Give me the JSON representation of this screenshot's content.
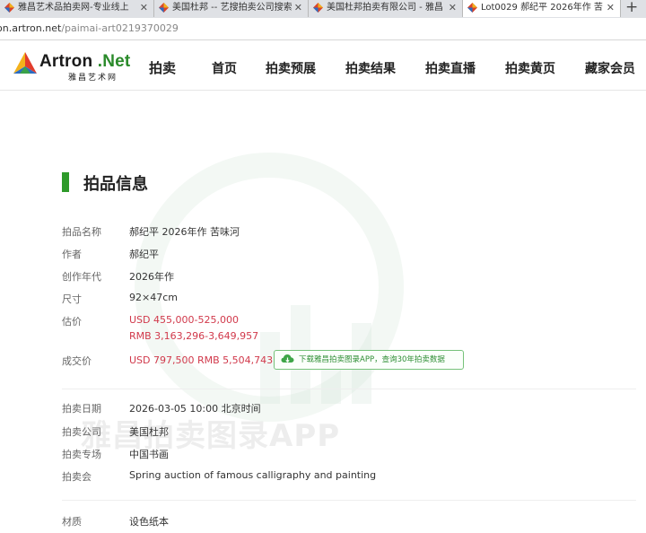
{
  "tabs": [
    {
      "label": "雅昌艺术品拍卖网-专业线上",
      "active": false
    },
    {
      "label": "美国杜邦 -- 艺搜拍卖公司搜索",
      "active": false
    },
    {
      "label": "美国杜邦拍卖有限公司 - 雅昌",
      "active": false
    },
    {
      "label": "Lot0029 郝纪平 2026年作 苦",
      "active": true
    }
  ],
  "new_tab_label": "+",
  "address": {
    "host": "on.artron.net",
    "path": "/paimai-art0219370029"
  },
  "logo": {
    "name": "Artron",
    "dot_net": ".Net",
    "subtitle": "雅昌艺术网"
  },
  "nav": {
    "section": "拍卖",
    "items": [
      "首页",
      "拍卖预展",
      "拍卖结果",
      "拍卖直播",
      "拍卖黄页",
      "藏家会员"
    ]
  },
  "section_title": "拍品信息",
  "details": {
    "name_label": "拍品名称",
    "name_value": "郝纪平 2026年作 苦味河",
    "author_label": "作者",
    "author_value": "郝纪平",
    "year_label": "创作年代",
    "year_value": "2026年作",
    "size_label": "尺寸",
    "size_value": "92×47cm",
    "estimate_label": "估价",
    "estimate_usd": "USD 455,000-525,000",
    "estimate_rmb": "RMB 3,163,296-3,649,957",
    "deal_label": "成交价",
    "deal_value": "USD 797,500 RMB 5,504,743",
    "app_button": "下载雅昌拍卖图录APP，查询30年拍卖数据"
  },
  "auction": {
    "date_label": "拍卖日期",
    "date_value": "2026-03-05 10:00 北京时间",
    "company_label": "拍卖公司",
    "company_value": "美国杜邦",
    "special_label": "拍卖专场",
    "special_value": "中国书画",
    "session_label": "拍卖会",
    "session_value": "Spring auction of famous calligraphy and painting"
  },
  "material": {
    "label": "材质",
    "value": "设色纸本"
  },
  "watermark_text": "雅昌拍卖图录APP",
  "colors": {
    "accent_green": "#2e9a2a",
    "price_red": "#d1394b"
  }
}
